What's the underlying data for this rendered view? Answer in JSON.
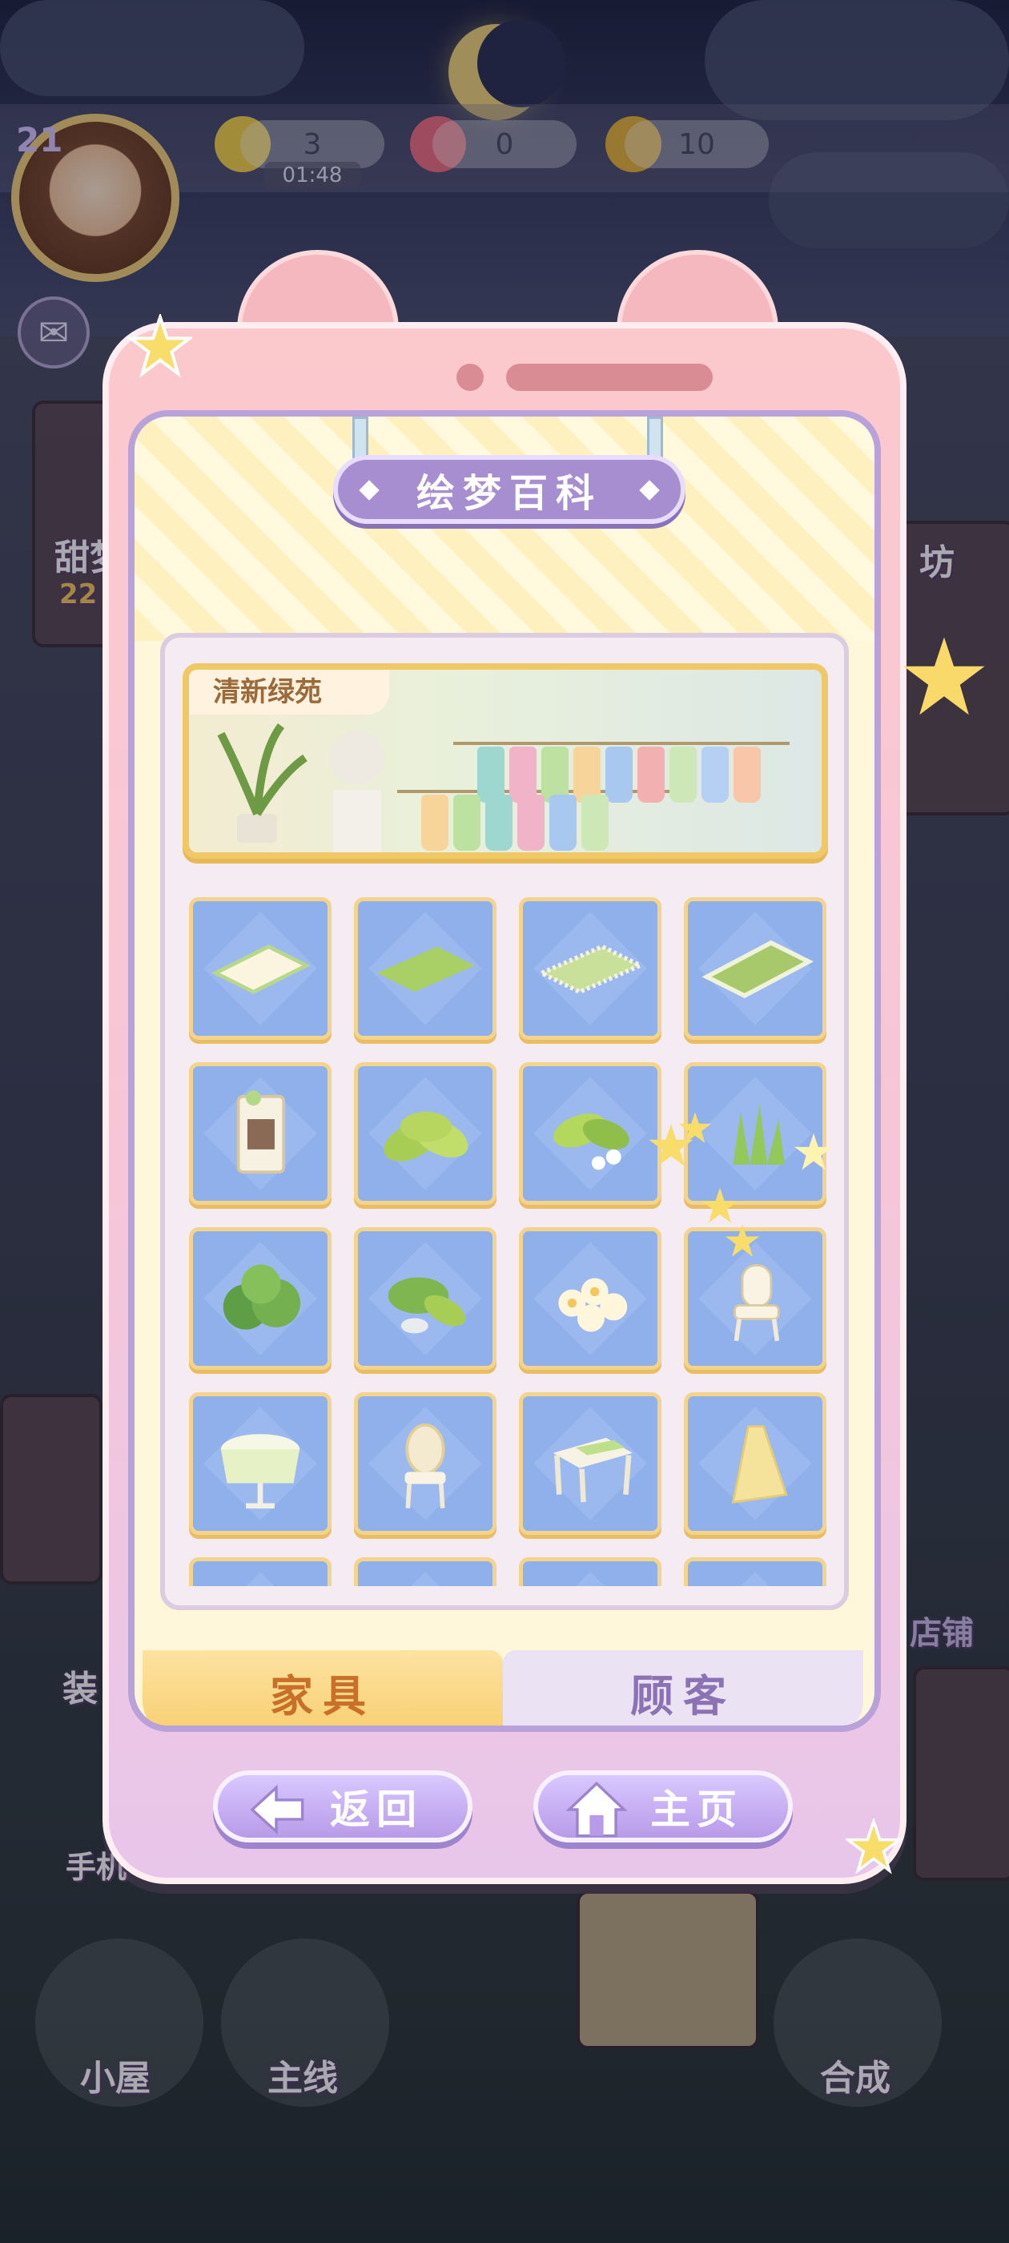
{
  "hud": {
    "level": "21",
    "energy": "3",
    "energy_timer": "01:48",
    "gems": "0",
    "coins": "10"
  },
  "background": {
    "left_shop_label": "甜梦",
    "left_shop_value": "22",
    "left_label_2": "装",
    "left_label_phone": "手机",
    "right_label_top": "坊",
    "right_label_shop": "店铺",
    "bottom_nav": {
      "house": "小屋",
      "main": "主线",
      "merge": "合成"
    }
  },
  "modal": {
    "title": "绘梦百科",
    "theme_name": "清新绿苑",
    "items": [
      {
        "name": "white-rug",
        "icon": "rug-icon"
      },
      {
        "name": "green-rug",
        "icon": "rug-icon"
      },
      {
        "name": "fringed-green-rug",
        "icon": "rug-icon"
      },
      {
        "name": "striped-green-rug",
        "icon": "rug-icon"
      },
      {
        "name": "floral-screen",
        "icon": "screen-icon"
      },
      {
        "name": "leafy-plant",
        "icon": "plant-icon"
      },
      {
        "name": "plant-with-flowers",
        "icon": "plant-icon"
      },
      {
        "name": "grass-clump",
        "icon": "grass-icon"
      },
      {
        "name": "monstera-bush",
        "icon": "plant-icon"
      },
      {
        "name": "fern-with-rock",
        "icon": "plant-icon"
      },
      {
        "name": "white-flower-bush",
        "icon": "flower-icon"
      },
      {
        "name": "white-chair",
        "icon": "chair-icon"
      },
      {
        "name": "round-table",
        "icon": "table-icon"
      },
      {
        "name": "ornate-chair",
        "icon": "chair-icon"
      },
      {
        "name": "side-table",
        "icon": "table-icon"
      },
      {
        "name": "paper-lamp",
        "icon": "lamp-icon"
      }
    ],
    "tabs": {
      "furniture": "家具",
      "customers": "顾客"
    },
    "buttons": {
      "back": "返回",
      "home": "主页"
    }
  },
  "colors": {
    "phone_pink": "#fbc9cc",
    "title_purple": "#a68ed0",
    "cell_blue": "#8fb0ea",
    "cell_border_gold": "#f3d48a",
    "tab_active_text": "#c86f2a"
  }
}
